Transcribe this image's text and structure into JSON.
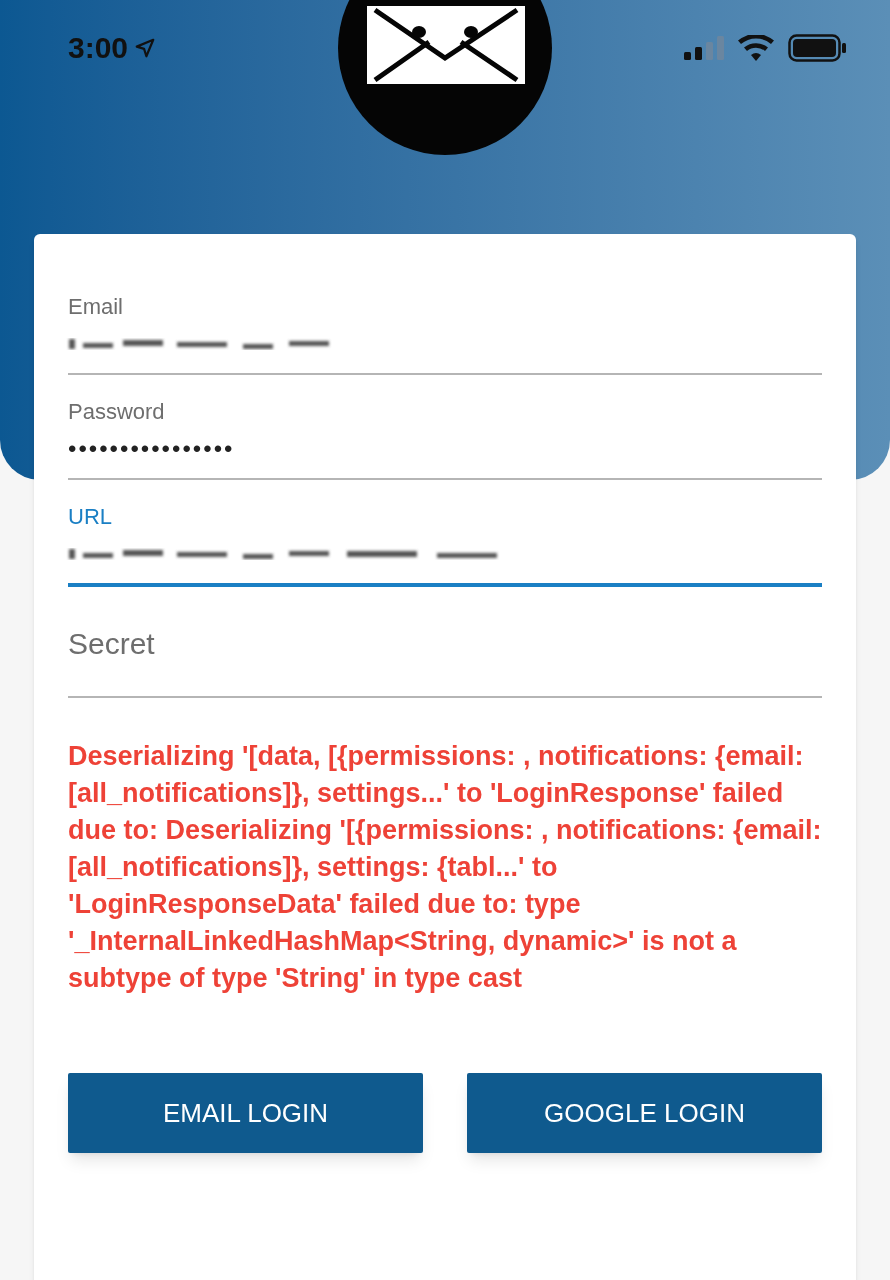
{
  "status_bar": {
    "time": "3:00",
    "location_on": true
  },
  "form": {
    "fields": [
      {
        "kind": "text",
        "label": "Email",
        "value_redacted": true,
        "focused": false
      },
      {
        "kind": "password",
        "label": "Password",
        "value": "••••••••••••••••",
        "focused": false
      },
      {
        "kind": "text",
        "label": "URL",
        "value_redacted": true,
        "focused": true
      },
      {
        "kind": "empty",
        "placeholder": "Secret",
        "focused": false
      }
    ],
    "error": "Deserializing '[data, [{permissions: , notifications: {email: [all_notifications]}, settings...' to 'LoginResponse' failed due to: Deserializing '[{permissions: , notifications: {email: [all_notifications]}, settings: {tabl...' to 'LoginResponseData' failed due to: type '_InternalLinkedHashMap<String, dynamic>' is not a subtype of type 'String' in type cast",
    "buttons": [
      "EMAIL LOGIN",
      "GOOGLE LOGIN"
    ]
  }
}
